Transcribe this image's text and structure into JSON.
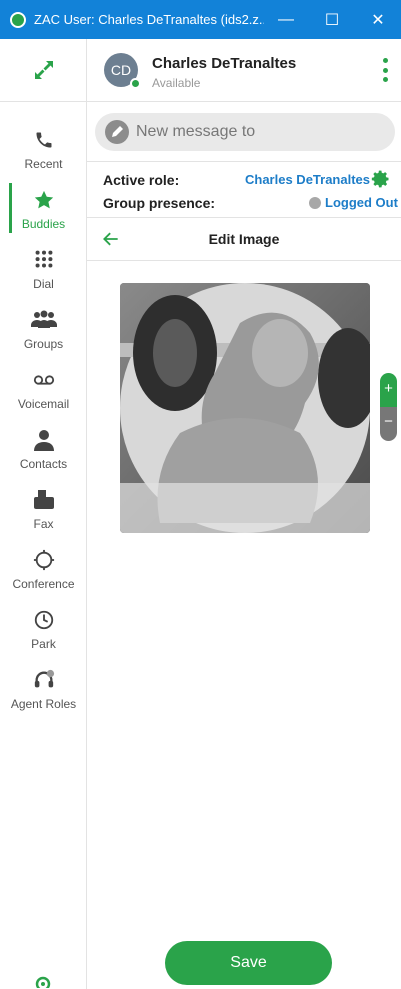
{
  "window": {
    "title": "ZAC User: Charles DeTranaltes (ids2.z...",
    "minimize": "—",
    "maximize": "☐",
    "close": "✕",
    "accent": "#1282d8"
  },
  "sidebar": {
    "items": [
      {
        "label": "Recent",
        "icon": "phone-icon"
      },
      {
        "label": "Buddies",
        "icon": "star-icon"
      },
      {
        "label": "Dial",
        "icon": "dialpad-icon"
      },
      {
        "label": "Groups",
        "icon": "groups-icon"
      },
      {
        "label": "Voicemail",
        "icon": "voicemail-icon"
      },
      {
        "label": "Contacts",
        "icon": "contact-icon"
      },
      {
        "label": "Fax",
        "icon": "fax-icon"
      },
      {
        "label": "Conference",
        "icon": "conference-icon"
      },
      {
        "label": "Park",
        "icon": "clock-icon"
      },
      {
        "label": "Agent Roles",
        "icon": "headset-icon"
      }
    ],
    "active": "Buddies",
    "accent": "#2aa34a"
  },
  "profile": {
    "initials": "CD",
    "name": "Charles DeTranaltes",
    "status": "Available"
  },
  "compose": {
    "placeholder": "New message to"
  },
  "roles": {
    "active_role_label": "Active role:",
    "active_role_value": "Charles DeTranaltes",
    "group_presence_label": "Group presence:",
    "group_presence_value": "Logged Out"
  },
  "editor": {
    "title": "Edit Image",
    "zoom_in": "+",
    "zoom_out": "−",
    "save": "Save"
  }
}
